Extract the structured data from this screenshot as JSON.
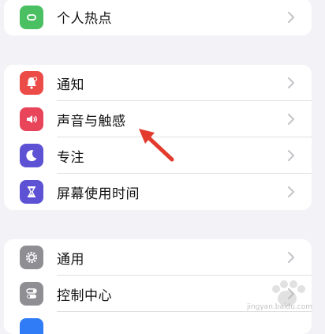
{
  "groups": [
    {
      "items": [
        {
          "label": "个人热点",
          "icon": "hotspot-icon",
          "color": "#4ac062"
        }
      ]
    },
    {
      "items": [
        {
          "label": "通知",
          "icon": "bell-icon",
          "color": "#ec4c47"
        },
        {
          "label": "声音与触感",
          "icon": "speaker-icon",
          "color": "#e8445a"
        },
        {
          "label": "专注",
          "icon": "moon-icon",
          "color": "#5e52d4"
        },
        {
          "label": "屏幕使用时间",
          "icon": "hourglass-icon",
          "color": "#5e52d4"
        }
      ]
    },
    {
      "items": [
        {
          "label": "通用",
          "icon": "gear-icon",
          "color": "#8e8e93"
        },
        {
          "label": "控制中心",
          "icon": "toggles-icon",
          "color": "#8e8e93"
        }
      ]
    }
  ],
  "watermark": {
    "text": "jingyan.baidu.com",
    "icon": "paw-icon"
  },
  "annotation": {
    "icon": "red-arrow-icon",
    "color": "#e23b2e"
  }
}
